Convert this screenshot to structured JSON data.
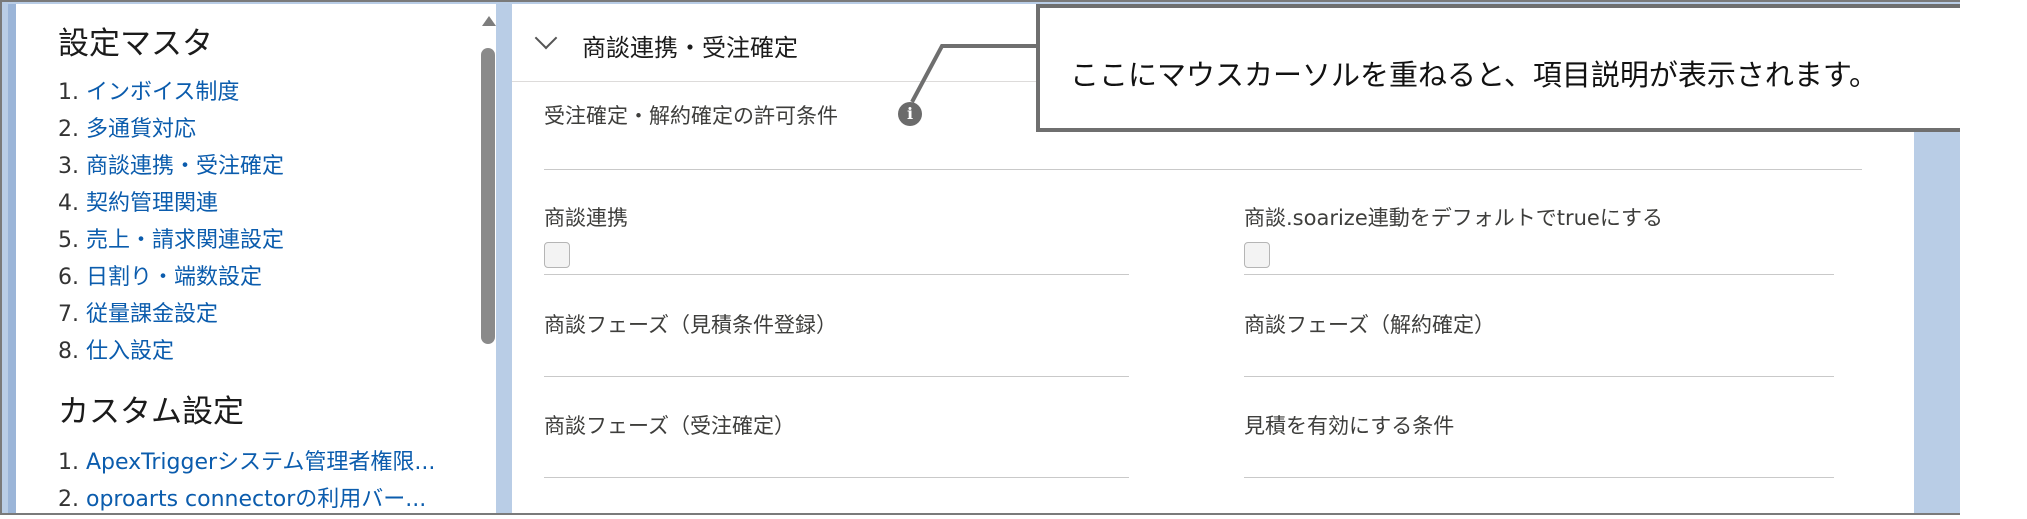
{
  "sidebar": {
    "master_title": "設定マスタ",
    "master_items": [
      {
        "num": "1. ",
        "label": "インボイス制度"
      },
      {
        "num": "2. ",
        "label": "多通貨対応"
      },
      {
        "num": "3. ",
        "label": "商談連携・受注確定"
      },
      {
        "num": "4. ",
        "label": "契約管理関連"
      },
      {
        "num": "5. ",
        "label": "売上・請求関連設定"
      },
      {
        "num": "6. ",
        "label": "日割り・端数設定"
      },
      {
        "num": "7. ",
        "label": "従量課金設定"
      },
      {
        "num": "8. ",
        "label": "仕入設定"
      }
    ],
    "custom_title": "カスタム設定",
    "custom_items": [
      {
        "num": "1. ",
        "label": "ApexTriggerシステム管理者権限..."
      },
      {
        "num": "2. ",
        "label": "oproarts connectorの利用バー..."
      }
    ]
  },
  "main": {
    "section_title": "商談連携・受注確定",
    "fields": {
      "permit_condition": "受注確定・解約確定の許可条件",
      "opportunity_link": "商談連携",
      "soarize_default_true": "商談.soarize連動をデフォルトでtrueにする",
      "phase_quote_register": "商談フェーズ（見積条件登録）",
      "phase_cancel_confirm": "商談フェーズ（解約確定）",
      "phase_order_confirm": "商談フェーズ（受注確定）",
      "quote_valid_condition": "見積を有効にする条件"
    },
    "info_icon_glyph": "i",
    "checkbox_values": {
      "opportunity_link": false,
      "soarize_default_true": false
    }
  },
  "callout": {
    "text": "ここにマウスカーソルを重ねると、項目説明が表示されます。"
  },
  "colors": {
    "link": "#0b5cad",
    "frame_background": "#b9cde6",
    "callout_border": "#6f6f6f"
  },
  "icons": [
    "chevron-down-icon",
    "info-icon",
    "scroll-up-arrow-icon"
  ]
}
